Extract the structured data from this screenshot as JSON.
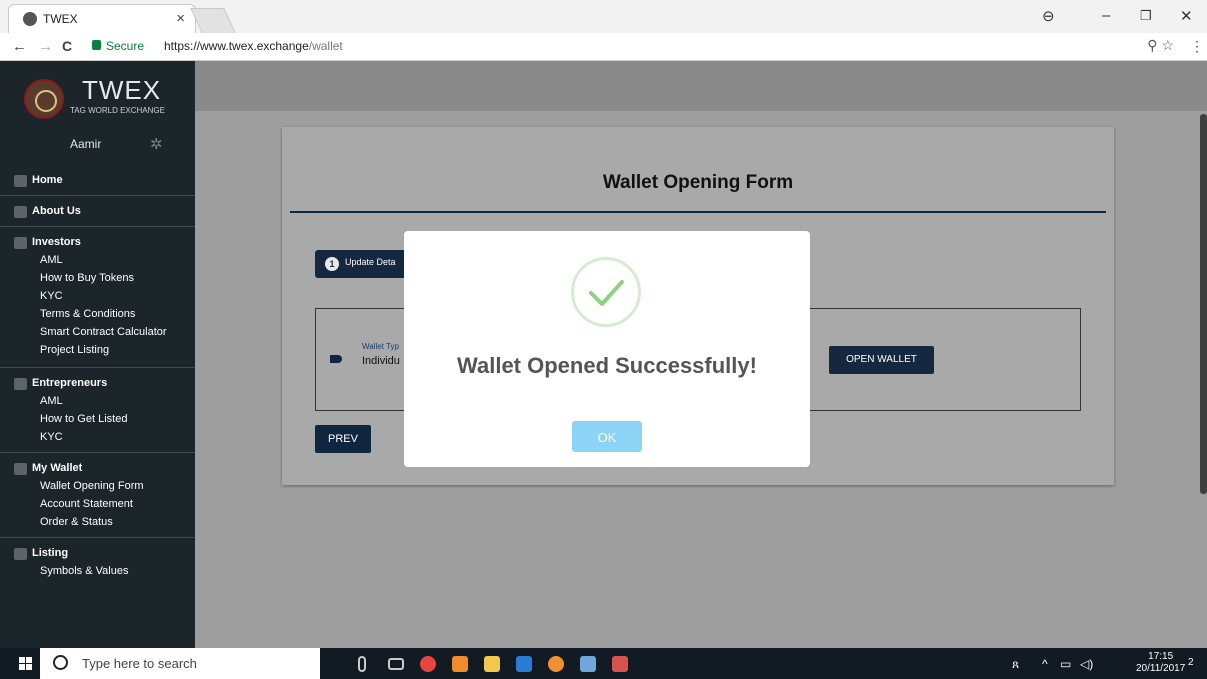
{
  "browser": {
    "tab_title": "TWEX",
    "tab_close": "×",
    "secure_label": "Secure",
    "url_base": "https://www.twex.exchange",
    "url_path": "/wallet",
    "zoom_star": "⚲ ☆",
    "menu_dots": "⋮",
    "back": "←",
    "forward": "→",
    "reload": "C",
    "profile": "⊖",
    "minimize": "–",
    "restore": "❐",
    "close": "✕"
  },
  "sidebar": {
    "brand": "TWEX",
    "brand_sub": "TAG WORLD EXCHANGE",
    "user": "Aamir",
    "items": [
      {
        "label": "Home"
      },
      {
        "label": "About Us"
      },
      {
        "label": "Investors"
      },
      {
        "label": "AML"
      },
      {
        "label": "How to Buy Tokens"
      },
      {
        "label": "KYC"
      },
      {
        "label": "Terms & Conditions"
      },
      {
        "label": "Smart Contract Calculator"
      },
      {
        "label": "Project Listing"
      },
      {
        "label": "Entrepreneurs"
      },
      {
        "label": "AML"
      },
      {
        "label": "How to Get Listed"
      },
      {
        "label": "KYC"
      },
      {
        "label": "My Wallet"
      },
      {
        "label": "Wallet Opening Form"
      },
      {
        "label": "Account Statement"
      },
      {
        "label": "Order & Status"
      },
      {
        "label": "Listing"
      },
      {
        "label": "Symbols & Values"
      }
    ]
  },
  "form": {
    "title": "Wallet Opening Form",
    "step_num": "1",
    "step_label": "Update Deta",
    "wallet_type_label": "Wallet Typ",
    "wallet_type_value": "Individu",
    "open_wallet": "OPEN WALLET",
    "prev": "PREV"
  },
  "modal": {
    "title": "Wallet Opened Successfully!",
    "ok": "OK"
  },
  "taskbar": {
    "search_placeholder": "Type here to search",
    "time": "17:15",
    "date": "20/11/2017",
    "notif_count": "2"
  }
}
